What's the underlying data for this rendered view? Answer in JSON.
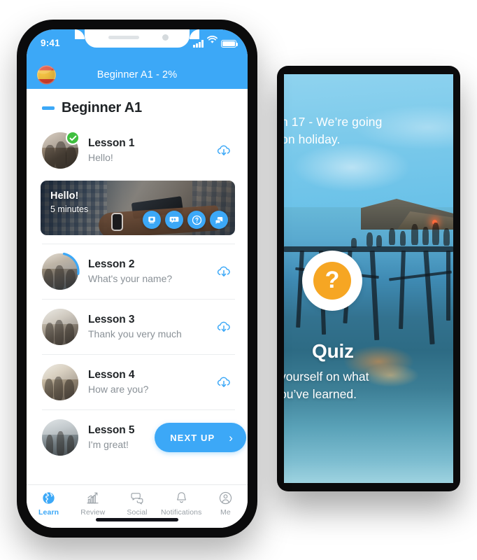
{
  "phone": {
    "status_bar": {
      "time": "9:41",
      "signal_icon": "signal-bars-icon",
      "wifi_icon": "wifi-icon",
      "battery_icon": "battery-icon"
    },
    "header": {
      "flag_icon": "spain-flag-icon",
      "title": "Beginner A1 - 2%"
    },
    "section": {
      "collapse_icon": "minus-collapse-icon",
      "title": "Beginner A1"
    },
    "lessons": [
      {
        "title": "Lesson 1",
        "subtitle": "Hello!",
        "state": "completed",
        "badge_icon": "check-circle-icon",
        "action_icon": "cloud-download-icon",
        "expanded": true
      },
      {
        "title": "Lesson 2",
        "subtitle": "What's your name?",
        "state": "in-progress",
        "action_icon": "cloud-download-icon",
        "expanded": false
      },
      {
        "title": "Lesson 3",
        "subtitle": "Thank you very much",
        "state": "locked",
        "action_icon": "cloud-download-icon",
        "expanded": false
      },
      {
        "title": "Lesson 4",
        "subtitle": "How are you?",
        "state": "locked",
        "action_icon": "cloud-download-icon",
        "expanded": false
      },
      {
        "title": "Lesson 5",
        "subtitle": "I'm great!",
        "state": "next",
        "action_label": "NEXT UP",
        "action_chevron": "chevron-right-icon",
        "expanded": false
      }
    ],
    "lesson_card": {
      "title": "Hello!",
      "duration": "5 minutes",
      "actions": [
        {
          "icon": "video-lesson-icon",
          "name": "video-button"
        },
        {
          "icon": "vocabulary-quote-icon",
          "name": "vocabulary-button"
        },
        {
          "icon": "question-mark-icon",
          "name": "quiz-button"
        },
        {
          "icon": "chat-bubbles-icon",
          "name": "conversation-button"
        }
      ]
    },
    "tabbar": [
      {
        "label": "Learn",
        "icon": "globe-icon",
        "active": true
      },
      {
        "label": "Review",
        "icon": "bar-chart-icon",
        "active": false
      },
      {
        "label": "Social",
        "icon": "chat-bubble-icon",
        "active": false
      },
      {
        "label": "Notifications",
        "icon": "bell-icon",
        "active": false
      },
      {
        "label": "Me",
        "icon": "person-icon",
        "active": false
      }
    ]
  },
  "tablet": {
    "headline": "n 17 - We’re going",
    "headline_line2": "on holiday.",
    "quiz_badge_icon": "question-mark-icon",
    "quiz_title": "Quiz",
    "quiz_subtitle": "yourself on what",
    "quiz_subtitle_line2": "ou’ve learned."
  },
  "colors": {
    "accent_blue": "#3ca8f7",
    "success_green": "#3fbf3f",
    "quiz_orange": "#f6a623",
    "text_dark": "#1f2326",
    "text_muted": "#8a9197"
  }
}
